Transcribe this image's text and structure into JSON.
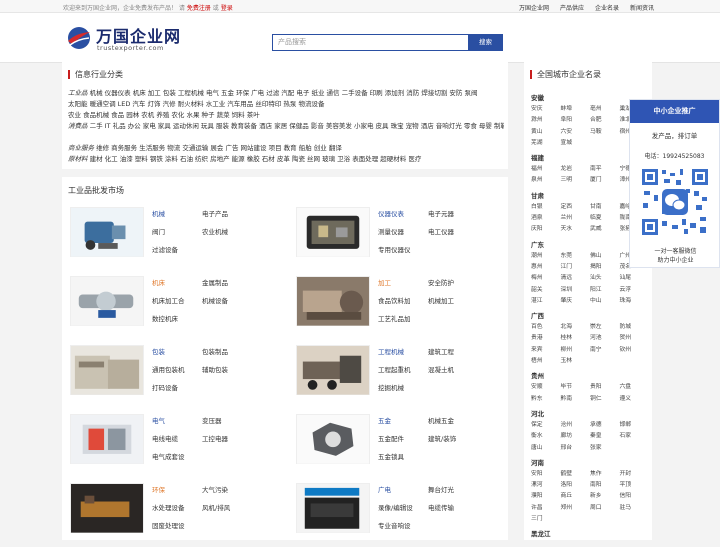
{
  "topbar": {
    "welcome": "欢迎来到万国企业网，企业免费发布产品！ 请",
    "register": "免费注册",
    "or": "或",
    "login": "登录",
    "nav": [
      "万国企业网",
      "产品供应",
      "企业名录",
      "新闻资讯"
    ]
  },
  "logo": {
    "name": "万国企业网",
    "domain": "trustexporter.com"
  },
  "search": {
    "placeholder": "产品搜索",
    "button": "搜索"
  },
  "info": {
    "title": "信息行业分类",
    "lines": [
      {
        "cat": "工业品",
        "items": "机械 仪器仪表 机床 加工 包装 工程机械 电气 五金 环保 广电 过滤 汽配 电子 纸业 通信 二手设备 印刷 添加剂 消防 焊接切割 安防 泵阀"
      },
      {
        "cat": "",
        "items": "太阳能 暖通空调 LED 汽车 灯饰 汽修 耐火材料 水工业 汽车用品 丝印特印 热泵 物流设备"
      },
      {
        "cat": "",
        "items": "农业 食品机械 食品 园林 农机 养殖 农化 水果 种子 蔬菜 饲料 茶叶"
      },
      {
        "cat": "消费品",
        "items": "二手 IT 礼品 办公 家电 家具 运动休闲 玩具 服装 教育装备 酒店 家居 保健品 影音 美容美发 小家电 皮具 珠宝 宠物 酒店 音响灯光 零食 母婴 制鞋"
      },
      {
        "cat": "商业服务",
        "items": "维修 商务服务 生活服务 物流 交通运输 展会 广告 网站建设 项目 教育 船舶 创业 翻译"
      },
      {
        "cat": "原材料",
        "items": "建材 化工 油漆 塑料 钢铁 涂料 石油 纺织 房地产 能源 橡胶 石材 皮革 陶瓷 丝网 玻璃 卫浴 表面处理 超硬材料 医疗"
      }
    ]
  },
  "market": {
    "title": "工业品批发市场",
    "cells": [
      {
        "head": "机械",
        "items": [
          "电子产品",
          "阀门",
          "农业机械",
          "过滤设备"
        ]
      },
      {
        "head": "仪器仪表",
        "items": [
          "电子元器",
          "测量仪器",
          "电工仪器",
          "专用仪器仪"
        ]
      },
      {
        "head": "机床",
        "items": [
          "金属制品",
          "机床加工合",
          "机械设备",
          "数控机床"
        ]
      },
      {
        "head": "加工",
        "items": [
          "安全防护",
          "食品饮料加",
          "机械加工",
          "工艺礼品加"
        ]
      },
      {
        "head": "包装",
        "items": [
          "包装制品",
          "通用包装机",
          "辅助包装",
          "打码设备"
        ]
      },
      {
        "head": "工程机械",
        "items": [
          "建筑工程",
          "工程起重机",
          "混凝土机",
          "挖掘机械"
        ]
      },
      {
        "head": "电气",
        "items": [
          "变压器",
          "电线电缆",
          "工控电器",
          "电气成套设"
        ]
      },
      {
        "head": "五金",
        "items": [
          "机械五金",
          "五金配件",
          "建筑/装饰",
          "五金锁具"
        ]
      },
      {
        "head": "环保",
        "items": [
          "大气污染",
          "水处理设备",
          "风机/排风",
          "固废处理设"
        ]
      },
      {
        "head": "广电",
        "items": [
          "舞台灯光",
          "录像/编辑设",
          "电缆传输",
          "专业音响设"
        ]
      }
    ]
  },
  "side": {
    "title": "全国城市企业名录",
    "provinces": [
      {
        "name": "安徽",
        "cities": [
          "安庆",
          "蚌埠",
          "亳州",
          "巢湖",
          "滁州",
          "阜阳",
          "合肥",
          "淮北",
          "黄山",
          "六安",
          "马鞍",
          "宿州",
          "芜湖",
          "宣城"
        ]
      },
      {
        "name": "福建",
        "cities": [
          "福州",
          "龙岩",
          "南平",
          "宁德",
          "泉州",
          "三明",
          "厦门",
          "漳州"
        ]
      },
      {
        "name": "甘肃",
        "cities": [
          "白银",
          "定西",
          "甘南",
          "嘉峪",
          "酒泉",
          "兰州",
          "临夏",
          "陇南",
          "庆阳",
          "天水",
          "武威",
          "张掖"
        ]
      },
      {
        "name": "广东",
        "cities": [
          "潮州",
          "东莞",
          "佛山",
          "广州",
          "惠州",
          "江门",
          "揭阳",
          "茂名",
          "梅州",
          "清远",
          "汕头",
          "汕尾",
          "韶关",
          "深圳",
          "阳江",
          "云浮",
          "湛江",
          "肇庆",
          "中山",
          "珠海"
        ]
      },
      {
        "name": "广西",
        "cities": [
          "百色",
          "北海",
          "崇左",
          "防城",
          "贵港",
          "桂林",
          "河池",
          "贺州",
          "来宾",
          "柳州",
          "南宁",
          "钦州",
          "梧州",
          "玉林"
        ]
      },
      {
        "name": "贵州",
        "cities": [
          "安顺",
          "毕节",
          "贵阳",
          "六盘",
          "黔东",
          "黔南",
          "铜仁",
          "遵义"
        ]
      },
      {
        "name": "河北",
        "cities": [
          "保定",
          "沧州",
          "承德",
          "邯郸",
          "衡水",
          "廊坊",
          "秦皇",
          "石家",
          "唐山",
          "邢台",
          "张家"
        ]
      },
      {
        "name": "河南",
        "cities": [
          "安阳",
          "鹤壁",
          "焦作",
          "开封",
          "漯河",
          "洛阳",
          "南阳",
          "平顶",
          "濮阳",
          "商丘",
          "新乡",
          "信阳",
          "许昌",
          "郑州",
          "周口",
          "驻马",
          "三门"
        ]
      },
      {
        "name": "黑龙江",
        "cities": []
      }
    ]
  },
  "float": {
    "title": "中小企业推广",
    "line1": "发产品，排订单",
    "tel": "电话：19924525083",
    "q1": "一对一客服微信",
    "q2": "助力中小企业"
  },
  "colors": {
    "brand": "#2a4fa2",
    "accent": "#c81e1e"
  }
}
